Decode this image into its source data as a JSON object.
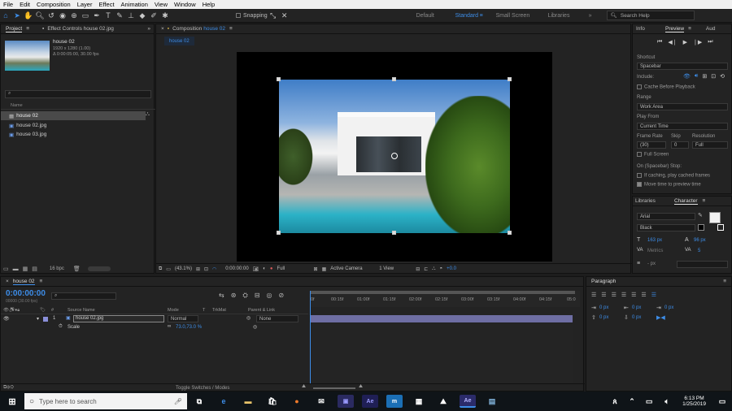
{
  "menu": [
    "File",
    "Edit",
    "Composition",
    "Layer",
    "Effect",
    "Animation",
    "View",
    "Window",
    "Help"
  ],
  "toolbar": {
    "snapping": "Snapping",
    "workspaces": [
      "Default",
      "Standard",
      "Small Screen",
      "Libraries"
    ],
    "active_workspace": "Standard",
    "search_placeholder": "Search Help"
  },
  "project": {
    "tab": "Project",
    "effect_tab": "Effect Controls house 02.jpg",
    "item_name": "house 02",
    "item_dims": "1920 x 1280 (1.00)",
    "item_duration": "Δ 0:00:05:00, 30.00 fps",
    "column_name": "Name",
    "items": [
      "house 02",
      "house 02.jpg",
      "house 03.jpg"
    ],
    "bpc": "16 bpc"
  },
  "composition": {
    "tab_label": "Composition",
    "tab_name": "house 02",
    "subtab": "house 02",
    "zoom": "(43.1%)",
    "timecode": "0:00:00:00",
    "quality": "Full",
    "camera": "Active Camera",
    "views": "1 View",
    "exposure": "+0.0"
  },
  "info_panel": {
    "tabs": [
      "Info",
      "Preview",
      "Aud"
    ],
    "shortcut_label": "Shortcut",
    "shortcut_value": "Spacebar",
    "include_label": "Include:",
    "cache_label": "Cache Before Playback",
    "range_label": "Range",
    "range_value": "Work Area",
    "play_from_label": "Play From",
    "play_from_value": "Current Time",
    "frame_rate_label": "Frame Rate",
    "skip_label": "Skip",
    "resolution_label": "Resolution",
    "frame_rate_value": "(30)",
    "skip_value": "0",
    "resolution_value": "Full",
    "full_screen_label": "Full Screen",
    "stop_label": "On (Spacebar) Stop:",
    "stop_option1": "If caching, play cached frames",
    "stop_option2": "Move time to preview time"
  },
  "character": {
    "tabs": [
      "Libraries",
      "Character"
    ],
    "font": "Arial",
    "style": "Black",
    "size": "163 px",
    "leading": "96 px",
    "kerning": "Metrics",
    "tracking": "5",
    "stroke": "- px"
  },
  "paragraph": {
    "tab": "Paragraph",
    "indent_left": "0 px",
    "indent_right": "0 px",
    "indent_first": "0 px",
    "space_before": "0 px",
    "space_after": "0 px"
  },
  "timeline": {
    "tab": "house 02",
    "timecode": "0:00:00:00",
    "frames": "00000 (30.00 fps)",
    "columns": [
      "#",
      "Source Name",
      "Mode",
      "T",
      "TrkMat",
      "Parent & Link"
    ],
    "layer_num": "1",
    "layer_name": "house 02.jpg",
    "layer_mode": "Normal",
    "layer_parent": "None",
    "scale_label": "Scale",
    "scale_value": "73.0,73.0 %",
    "ruler": [
      "0f",
      "00:15f",
      "01:00f",
      "01:15f",
      "02:00f",
      "02:15f",
      "03:00f",
      "03:15f",
      "04:00f",
      "04:15f",
      "05:0"
    ],
    "toggle_label": "Toggle Switches / Modes"
  },
  "taskbar": {
    "search_placeholder": "Type here to search",
    "time": "6:13 PM",
    "date": "1/25/2019"
  },
  "colors": {
    "accent": "#3d8de8",
    "panel_bg": "#232323",
    "app_bg": "#1d1d1d",
    "taskbar_bg": "#0f1418"
  }
}
